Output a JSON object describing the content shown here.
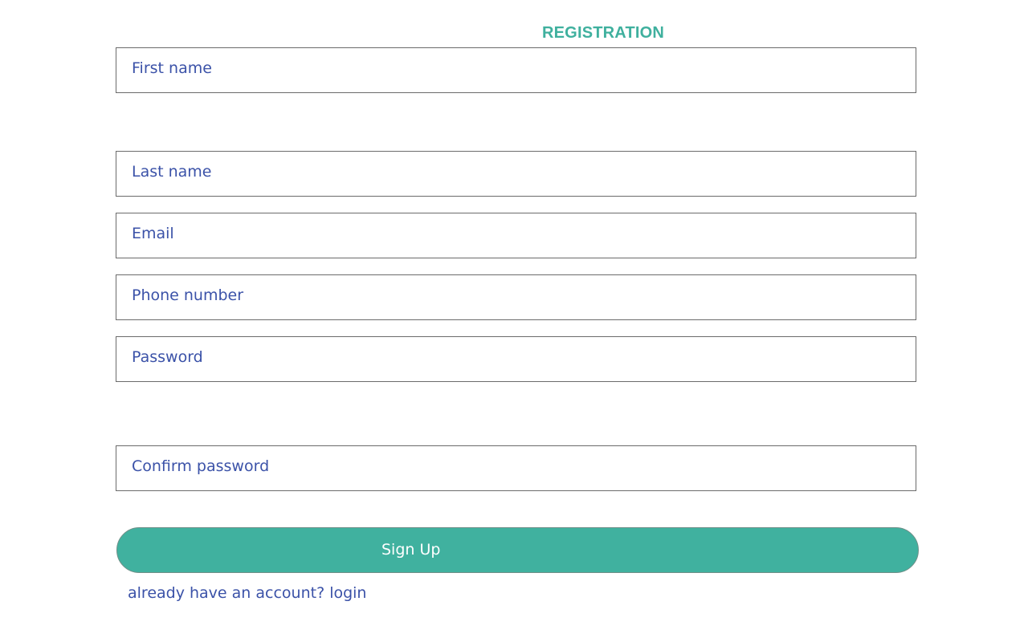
{
  "header": {
    "title": "REGISTRATION"
  },
  "form": {
    "first_name": {
      "placeholder": "First name",
      "value": ""
    },
    "last_name": {
      "placeholder": "Last name",
      "value": ""
    },
    "email": {
      "placeholder": "Email",
      "value": ""
    },
    "phone": {
      "placeholder": "Phone number",
      "value": ""
    },
    "password": {
      "placeholder": "Password",
      "value": ""
    },
    "confirm_password": {
      "placeholder": "Confirm password",
      "value": ""
    },
    "submit_label": "Sign Up",
    "login_link": "already have an account? login"
  },
  "colors": {
    "accent": "#40b19f",
    "text": "#3b52a8",
    "border": "#6b6b6b",
    "background": "#ffffff"
  }
}
